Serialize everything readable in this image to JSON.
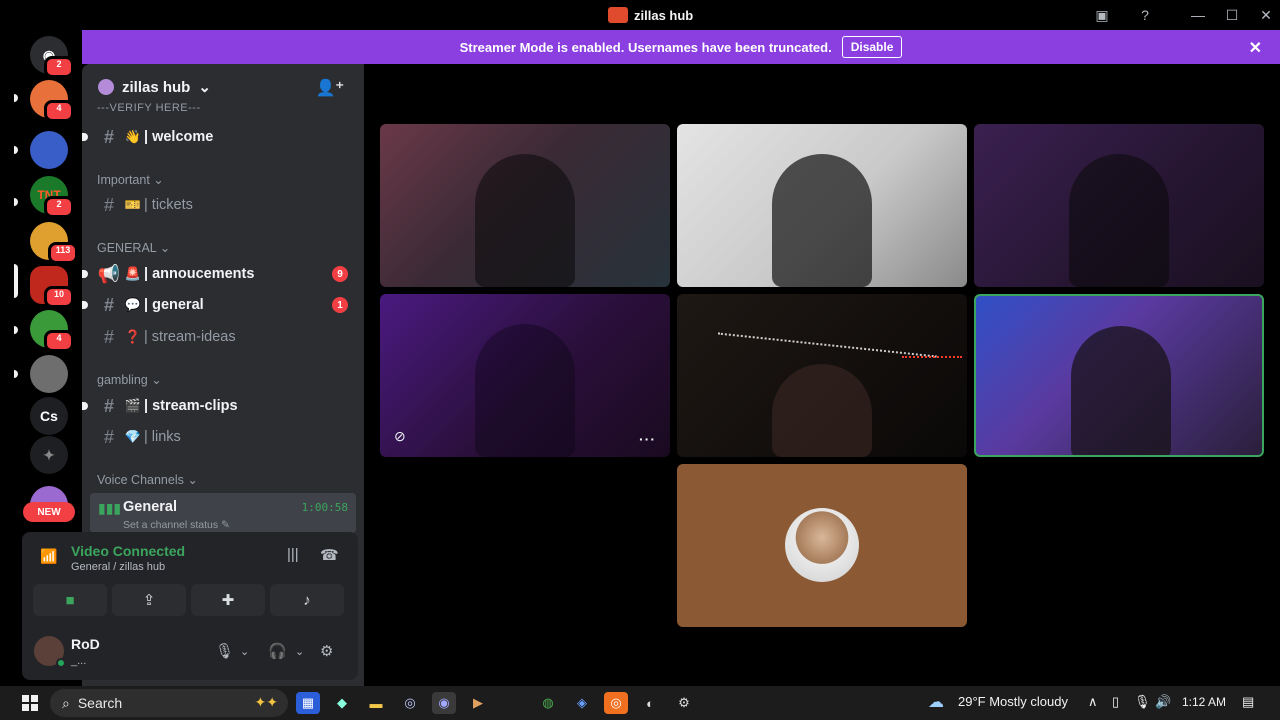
{
  "window": {
    "title": "zillas hub"
  },
  "banner": {
    "message": "Streamer Mode is enabled. Usernames have been truncated.",
    "disable_label": "Disable"
  },
  "rail": {
    "servers": [
      {
        "name": "discord-home",
        "badge": "2",
        "color": "#5865f2",
        "initials": ""
      },
      {
        "name": "server-1",
        "badge": "4",
        "color": "#e8703a",
        "initials": ""
      },
      {
        "name": "server-2",
        "badge": "",
        "color": "#3a5ec8",
        "initials": ""
      },
      {
        "name": "server-tnt",
        "badge": "2",
        "color": "#1a7a2a",
        "initials": "TNT"
      },
      {
        "name": "server-4",
        "badge": "113",
        "color": "#e0a030",
        "initials": ""
      },
      {
        "name": "server-5",
        "badge": "10",
        "color": "#c0281e",
        "initials": ""
      },
      {
        "name": "server-6",
        "badge": "4",
        "color": "#3a9a3a",
        "initials": ""
      },
      {
        "name": "server-7",
        "badge": "",
        "color": "#6e6e6e",
        "initials": ""
      },
      {
        "name": "server-cs",
        "badge": "",
        "color": "#1e1f22",
        "initials": "Cs"
      },
      {
        "name": "server-9",
        "badge": "",
        "color": "#1e1f22",
        "initials": ""
      }
    ],
    "new_label": "NEW"
  },
  "sidebar": {
    "server_name": "zillas hub",
    "verify_label": "---VERIFY HERE---",
    "categories": {
      "important": "Important",
      "general": "GENERAL",
      "gambling": "gambling",
      "voice": "Voice Channels"
    },
    "channels": {
      "welcome": {
        "emoji": "👋",
        "name": "| welcome"
      },
      "tickets": {
        "emoji": "🎫",
        "name": "| tickets"
      },
      "annoucements": {
        "emoji": "🚨",
        "name": "| annoucements",
        "mentions": "9"
      },
      "general": {
        "emoji": "💬",
        "name": "| general",
        "mentions": "1"
      },
      "stream_ideas": {
        "emoji": "❓",
        "name": "| stream-ideas"
      },
      "stream_clips": {
        "emoji": "🎬",
        "name": "| stream-clips"
      },
      "links": {
        "emoji": "💎",
        "name": "| links"
      }
    },
    "voice_channel": {
      "name": "General",
      "status": "Set a channel status",
      "timer": "1:00:58"
    }
  },
  "connection": {
    "state": "Video Connected",
    "location": "General / zillas hub"
  },
  "user": {
    "name": "RoD",
    "tag": "_..."
  },
  "taskbar": {
    "search_label": "Search",
    "weather": "29°F  Mostly cloudy",
    "time": "1:12 AM"
  }
}
